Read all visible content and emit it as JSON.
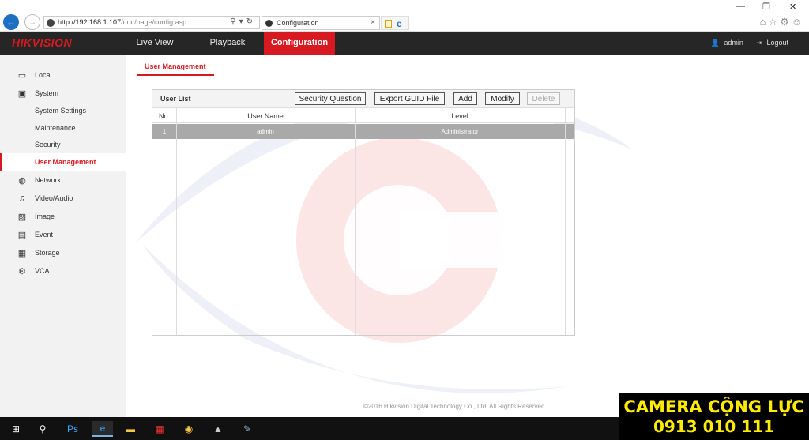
{
  "browser": {
    "url_main": "http://192.168.1.107",
    "url_path": "/doc/page/config.asp",
    "tab_title": "Configuration",
    "tab_close": "×",
    "minimize": "—",
    "restore": "❐",
    "close": "✕"
  },
  "header": {
    "logo": "HIKVISION",
    "menu": [
      "Live View",
      "Playback",
      "Configuration"
    ],
    "active_menu": "Configuration",
    "username": "admin",
    "logout": "Logout"
  },
  "sidebar": {
    "items": [
      {
        "label": "Local",
        "icon": "monitor-icon"
      },
      {
        "label": "System",
        "icon": "system-icon"
      },
      {
        "label": "System Settings"
      },
      {
        "label": "Maintenance"
      },
      {
        "label": "Security"
      },
      {
        "label": "User Management",
        "selected": true
      },
      {
        "label": "Network",
        "icon": "globe-icon"
      },
      {
        "label": "Video/Audio",
        "icon": "video-audio-icon"
      },
      {
        "label": "Image",
        "icon": "image-icon"
      },
      {
        "label": "Event",
        "icon": "event-icon"
      },
      {
        "label": "Storage",
        "icon": "storage-icon"
      },
      {
        "label": "VCA",
        "icon": "vca-icon"
      }
    ]
  },
  "main": {
    "subtab": "User Management",
    "panel_title": "User List",
    "buttons": {
      "security_question": "Security Question",
      "export_guid": "Export GUID File",
      "add": "Add",
      "modify": "Modify",
      "delete": "Delete"
    },
    "columns": [
      "No.",
      "User Name",
      "Level"
    ],
    "rows": [
      {
        "no": "1",
        "user": "admin",
        "level": "Administrator"
      }
    ]
  },
  "footer": {
    "copyright": "©2016 Hikvision Digital Technology Co., Ltd. All Rights Reserved."
  },
  "promo": {
    "line1": "CAMERA CỘNG LỰC",
    "line2": "0913 010 111"
  },
  "colors": {
    "accent": "#d71a21",
    "header_bg": "#262626",
    "sidebar_bg": "#f2f2f2"
  }
}
